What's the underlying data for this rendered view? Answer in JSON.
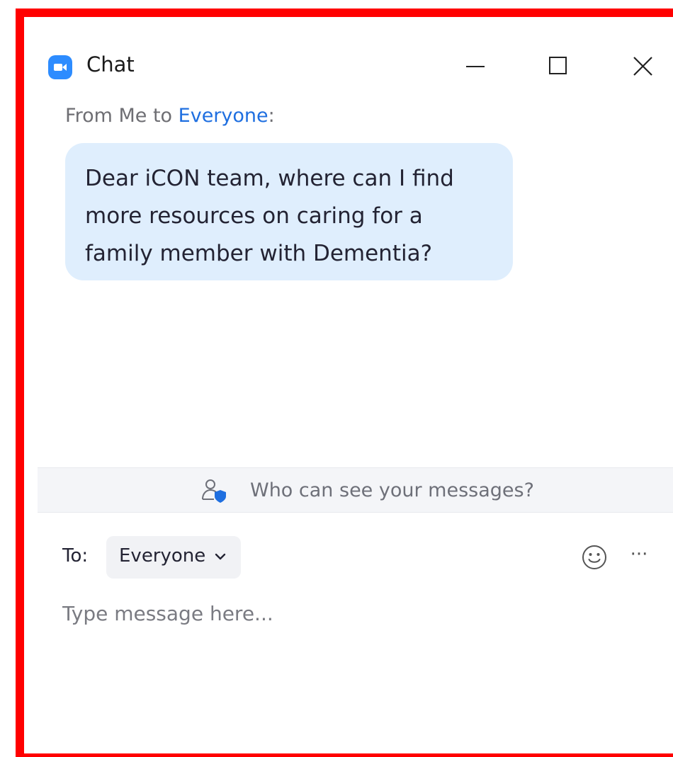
{
  "window": {
    "title": "Chat",
    "icon": "zoom-camera-icon",
    "controls": [
      "minimize-icon",
      "maximize-icon",
      "close-icon"
    ]
  },
  "message": {
    "prefix": "From Me to ",
    "recipient": "Everyone",
    "suffix": ":",
    "text": "Dear iCON team, where can I find more resources on caring for a family member with Dementia?"
  },
  "privacy": {
    "icon": "people-shield-icon",
    "text": "Who can see your messages?"
  },
  "compose": {
    "to_label": "To:",
    "recipient": "Everyone",
    "recipient_icon": "chevron-down-icon",
    "emoji_icon": "smiley-icon",
    "more_icon": "more-options-icon",
    "more_glyph": "···",
    "placeholder": "Type message here..."
  },
  "colors": {
    "accent": "#2d8cff",
    "link": "#1f6fe0",
    "bubble": "#dfeefd",
    "highlight_frame": "#ff0000"
  }
}
